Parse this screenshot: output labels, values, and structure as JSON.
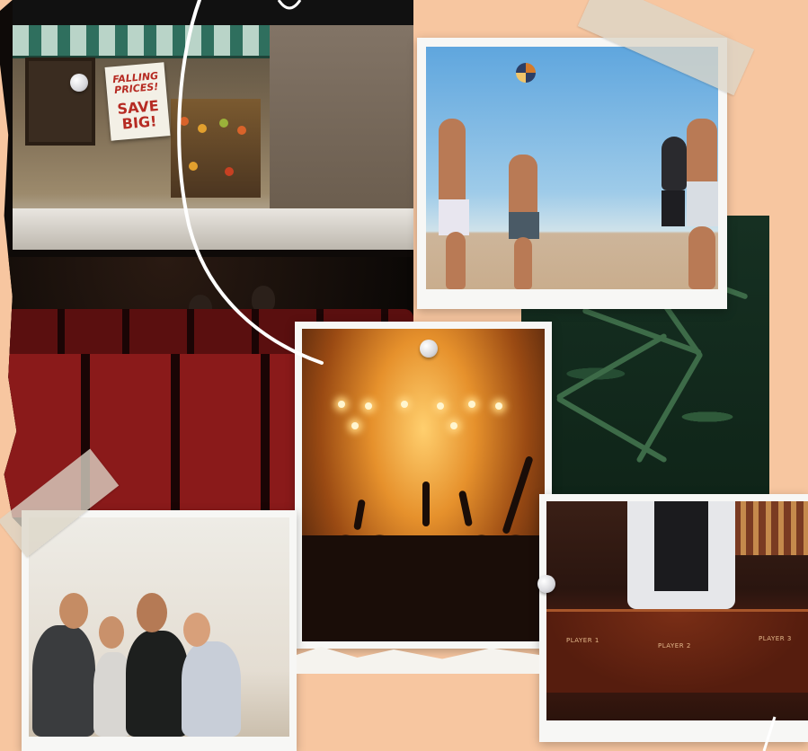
{
  "theatre": {
    "sign_line1": "FALLING PRICES!",
    "sign_line2": "SAVE BIG!"
  },
  "casino": {
    "table_labels": [
      "PLAYER 1",
      "PLAYER 2",
      "PLAYER 3"
    ]
  },
  "colors": {
    "background": "#f7c6a0",
    "frame": "#f7f7f5",
    "seat_red": "#8a1a1a",
    "concert_glow": "#e6912c",
    "sky": "#5fa6de",
    "felt": "#561d0e"
  },
  "icons": [
    "pushpin-icon",
    "tape-strip"
  ]
}
